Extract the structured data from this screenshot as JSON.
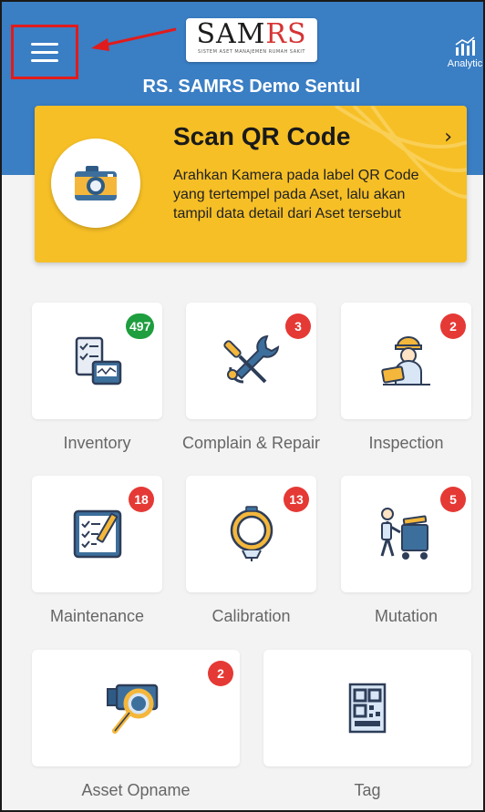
{
  "header": {
    "logo_text_main": "SAM",
    "logo_text_accent": "RS",
    "logo_subtitle": "SISTEM ASET MANAJEMEN RUMAH SAKIT",
    "hospital_name": "RS. SAMRS Demo Sentul",
    "analytic_label": "Analytic",
    "menu_icon": "hamburger-menu-icon",
    "colors": {
      "header_bg": "#3a7ec4",
      "highlight": "#e11b1b"
    }
  },
  "scan": {
    "title": "Scan QR Code",
    "description": "Arahkan Kamera pada label QR Code yang tertempel pada Aset, lalu akan tampil data detail dari Aset tersebut",
    "icon": "camera-icon",
    "chevron": "›",
    "color": "#f6bf26"
  },
  "tiles": [
    {
      "label": "Inventory",
      "badge": "497",
      "badge_color": "#1e9e3e",
      "icon": "inventory-checklist-icon"
    },
    {
      "label": "Complain & Repair",
      "badge": "3",
      "badge_color": "#e53935",
      "icon": "wrench-screwdriver-icon"
    },
    {
      "label": "Inspection",
      "badge": "2",
      "badge_color": "#e53935",
      "icon": "inspector-icon"
    },
    {
      "label": "Maintenance",
      "badge": "18",
      "badge_color": "#e53935",
      "icon": "maintenance-checklist-icon"
    },
    {
      "label": "Calibration",
      "badge": "13",
      "badge_color": "#e53935",
      "icon": "calibration-dial-icon"
    },
    {
      "label": "Mutation",
      "badge": "5",
      "badge_color": "#e53935",
      "icon": "cart-person-icon"
    },
    {
      "label": "Asset Opname",
      "badge": "2",
      "badge_color": "#e53935",
      "icon": "asset-search-icon"
    },
    {
      "label": "Tag",
      "badge": null,
      "icon": "qr-tag-icon"
    }
  ]
}
